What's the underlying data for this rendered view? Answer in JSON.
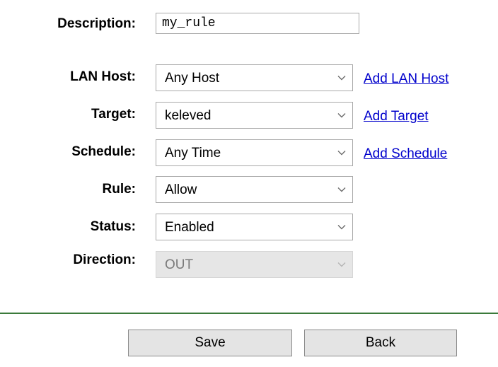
{
  "form": {
    "description": {
      "label": "Description:",
      "value": "my_rule"
    },
    "lan_host": {
      "label": "LAN Host:",
      "value": "Any Host",
      "link": "Add LAN Host"
    },
    "target": {
      "label": "Target:",
      "value": "keleved",
      "link": "Add Target"
    },
    "schedule": {
      "label": "Schedule:",
      "value": "Any Time",
      "link": "Add Schedule"
    },
    "rule": {
      "label": "Rule:",
      "value": "Allow"
    },
    "status": {
      "label": "Status:",
      "value": "Enabled"
    },
    "direction": {
      "label": "Direction:",
      "value": "OUT",
      "disabled": true
    }
  },
  "buttons": {
    "save": "Save",
    "back": "Back"
  },
  "colors": {
    "link": "#0000cc",
    "divider": "#3a7a3a",
    "button_bg": "#e4e4e4",
    "disabled_bg": "#e6e6e6"
  },
  "icons": {
    "dropdown": "chevron-down-icon"
  }
}
